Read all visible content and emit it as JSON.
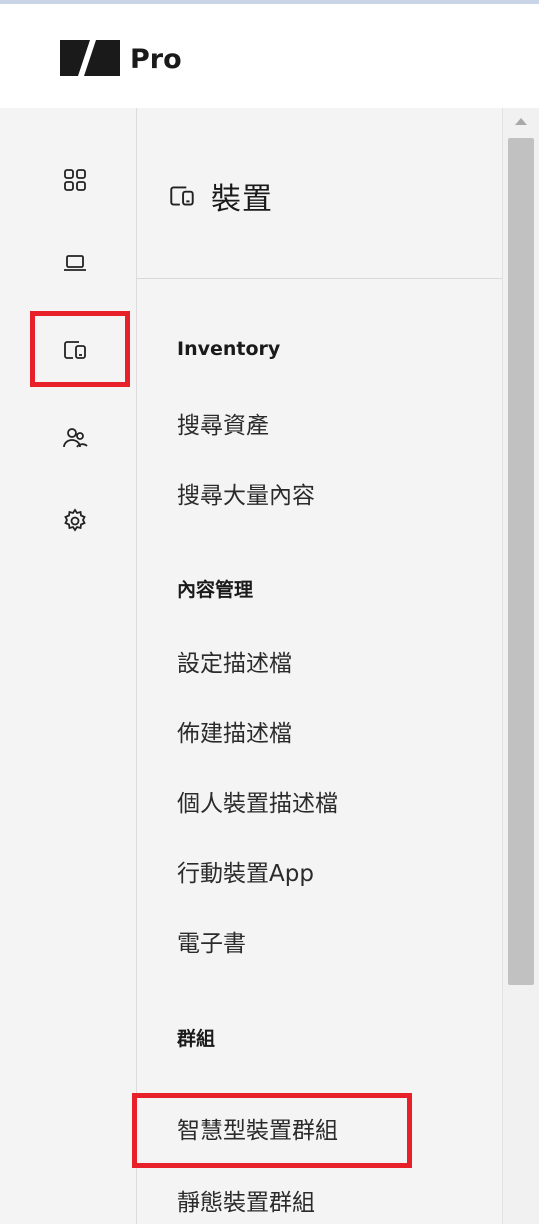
{
  "app": {
    "brand": "Pro"
  },
  "rail": {
    "items": [
      {
        "name": "dashboard-icon"
      },
      {
        "name": "laptop-icon"
      },
      {
        "name": "devices-icon",
        "active": true
      },
      {
        "name": "users-icon"
      },
      {
        "name": "gear-icon"
      }
    ]
  },
  "panel": {
    "title": "裝置",
    "sections": [
      {
        "label": "Inventory",
        "items": [
          "搜尋資產",
          "搜尋大量內容"
        ]
      },
      {
        "label": "內容管理",
        "items": [
          "設定描述檔",
          "佈建描述檔",
          "個人裝置描述檔",
          "行動裝置App",
          "電子書"
        ]
      },
      {
        "label": "群組",
        "items": [
          "智慧型裝置群組",
          "靜態裝置群組"
        ]
      }
    ]
  },
  "colors": {
    "highlight": "#e8202a",
    "rail_bg": "#f4f4f4"
  }
}
